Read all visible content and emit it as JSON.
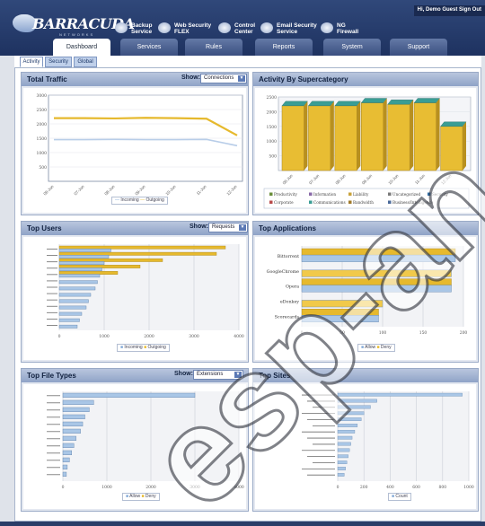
{
  "header": {
    "user_text": "Hi, Demo Guest  Sign Out",
    "logo_text": "BARRACUDA",
    "logo_sub": "NETWORKS",
    "products": [
      {
        "icon": "database-icon",
        "line1": "Backup",
        "line2": "Service"
      },
      {
        "icon": "cloud-icon",
        "line1": "Web Security",
        "line2": "FLEX"
      },
      {
        "icon": "control-icon",
        "line1": "Control",
        "line2": "Center"
      },
      {
        "icon": "mail-icon",
        "line1": "Email Security",
        "line2": "Service"
      },
      {
        "icon": "firewall-icon",
        "line1": "NG",
        "line2": "Firewall"
      }
    ]
  },
  "tabs": [
    "Dashboard",
    "Services",
    "Rules",
    "Reports",
    "System",
    "Support"
  ],
  "active_tab": "Dashboard",
  "subtabs": [
    "Activity",
    "Security",
    "Global"
  ],
  "active_subtab": "Activity",
  "panels": {
    "traffic": {
      "title": "Total Traffic",
      "show_label": "Show:",
      "select": "Connections"
    },
    "super": {
      "title": "Activity By Supercategory"
    },
    "users": {
      "title": "Top Users",
      "show_label": "Show:",
      "select": "Requests"
    },
    "apps": {
      "title": "Top Applications"
    },
    "files": {
      "title": "Top File Types",
      "show_label": "Show:",
      "select": "Extensions"
    },
    "sites": {
      "title": "Top Sites"
    }
  },
  "colors": {
    "gold": "#e6b92d",
    "blue": "#a9c6e6",
    "teal": "#3a9d94",
    "navy": "#2f4a85"
  },
  "watermark": "esp-an",
  "chart_data": [
    {
      "type": "line",
      "title": "Total Traffic",
      "yticks": [
        "3000",
        "2500",
        "2000",
        "1500",
        "1000",
        "500"
      ],
      "x": [
        "06-Jun",
        "07-Jun",
        "08-Jun",
        "09-Jun",
        "10-Jun",
        "11-Jun",
        "12-Jun"
      ],
      "ylim": [
        0,
        3000
      ],
      "series": [
        {
          "name": "Incoming",
          "values": [
            1450,
            1450,
            1460,
            1450,
            1450,
            1460,
            1240
          ]
        },
        {
          "name": "Outgoing",
          "values": [
            2200,
            2200,
            2190,
            2210,
            2200,
            2180,
            1600
          ]
        }
      ]
    },
    {
      "type": "bar",
      "title": "Activity By Supercategory",
      "yticks": [
        "2500",
        "2000",
        "1500",
        "1000",
        "500"
      ],
      "x": [
        "06-Jun",
        "07-Jun",
        "08-Jun",
        "09-Jun",
        "10-Jun",
        "11-Jun",
        "12-Jun"
      ],
      "ylim": [
        0,
        2500
      ],
      "series": [
        {
          "name": "Productivity",
          "values": [
            2200,
            2200,
            2200,
            2300,
            2250,
            2300,
            1500
          ]
        }
      ],
      "legend": [
        "Productivity",
        "Information",
        "Liability",
        "Uncategorized",
        "Security",
        "Corporate",
        "Communications",
        "Bandwidth",
        "Business/Intelligence"
      ]
    },
    {
      "type": "bar",
      "title": "Top Users",
      "xticks": [
        "0",
        "1000",
        "2000",
        "3000",
        "4000"
      ],
      "series": [
        {
          "name": "Incoming",
          "values": [
            1150,
            1100,
            1000,
            950,
            900,
            850,
            800,
            700,
            650,
            600,
            500,
            450,
            400
          ]
        },
        {
          "name": "Outgoing",
          "values": [
            3700,
            3500,
            2300,
            1800,
            1300,
            0,
            0,
            0,
            0,
            0,
            0,
            0,
            0
          ]
        }
      ],
      "legend": [
        "Incoming",
        "Outgoing"
      ]
    },
    {
      "type": "bar",
      "title": "Top Applications",
      "categories": [
        "Bittorrent",
        "GoogleChrome",
        "Opera",
        "eDonkey",
        "Scorecards"
      ],
      "xticks": [
        "0",
        "50",
        "100",
        "150",
        "200"
      ],
      "series": [
        {
          "name": "Allow",
          "values": [
            190,
            185,
            185,
            100,
            95
          ]
        },
        {
          "name": "Deny",
          "values": [
            190,
            0,
            185,
            0,
            95
          ]
        }
      ],
      "legend": [
        "Allow",
        "Deny"
      ]
    },
    {
      "type": "bar",
      "title": "Top File Types",
      "xticks": [
        "0",
        "1000",
        "2000",
        "3000",
        "4000"
      ],
      "series": [
        {
          "name": "Allow",
          "values": [
            3000,
            700,
            600,
            500,
            450,
            400,
            300,
            250,
            200,
            150,
            100,
            80
          ]
        }
      ],
      "legend": [
        "Allow",
        "Deny"
      ]
    },
    {
      "type": "bar",
      "title": "Top Sites",
      "xticks": [
        "0",
        "200",
        "400",
        "600",
        "800",
        "1000"
      ],
      "series": [
        {
          "name": "Count",
          "values": [
            950,
            300,
            250,
            200,
            180,
            150,
            130,
            110,
            100,
            90,
            80,
            70,
            60,
            50
          ]
        }
      ],
      "legend": [
        "Count"
      ]
    }
  ]
}
